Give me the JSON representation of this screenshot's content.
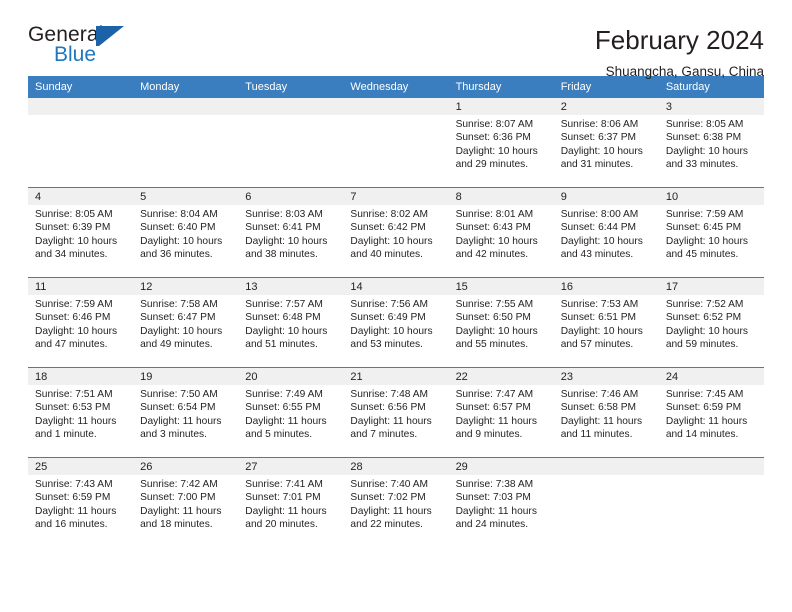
{
  "brand": {
    "word_one": "General",
    "word_two": "Blue",
    "flag_icon": "blue-flag-triangle-icon"
  },
  "header": {
    "month_title": "February 2024",
    "location": "Shuangcha, Gansu, China"
  },
  "colors": {
    "header_blue": "#3a7ebf",
    "row_divider_blue": "#3a7ebf",
    "daynum_band_gray": "#f0f0f0",
    "brand_blue": "#1f77bf",
    "text": "#231f20"
  },
  "calendar": {
    "day_headers": [
      "Sunday",
      "Monday",
      "Tuesday",
      "Wednesday",
      "Thursday",
      "Friday",
      "Saturday"
    ],
    "weeks": [
      [
        {
          "day": "",
          "lines": []
        },
        {
          "day": "",
          "lines": []
        },
        {
          "day": "",
          "lines": []
        },
        {
          "day": "",
          "lines": []
        },
        {
          "day": "1",
          "lines": [
            "Sunrise: 8:07 AM",
            "Sunset: 6:36 PM",
            "Daylight: 10 hours",
            "and 29 minutes."
          ]
        },
        {
          "day": "2",
          "lines": [
            "Sunrise: 8:06 AM",
            "Sunset: 6:37 PM",
            "Daylight: 10 hours",
            "and 31 minutes."
          ]
        },
        {
          "day": "3",
          "lines": [
            "Sunrise: 8:05 AM",
            "Sunset: 6:38 PM",
            "Daylight: 10 hours",
            "and 33 minutes."
          ]
        }
      ],
      [
        {
          "day": "4",
          "lines": [
            "Sunrise: 8:05 AM",
            "Sunset: 6:39 PM",
            "Daylight: 10 hours",
            "and 34 minutes."
          ]
        },
        {
          "day": "5",
          "lines": [
            "Sunrise: 8:04 AM",
            "Sunset: 6:40 PM",
            "Daylight: 10 hours",
            "and 36 minutes."
          ]
        },
        {
          "day": "6",
          "lines": [
            "Sunrise: 8:03 AM",
            "Sunset: 6:41 PM",
            "Daylight: 10 hours",
            "and 38 minutes."
          ]
        },
        {
          "day": "7",
          "lines": [
            "Sunrise: 8:02 AM",
            "Sunset: 6:42 PM",
            "Daylight: 10 hours",
            "and 40 minutes."
          ]
        },
        {
          "day": "8",
          "lines": [
            "Sunrise: 8:01 AM",
            "Sunset: 6:43 PM",
            "Daylight: 10 hours",
            "and 42 minutes."
          ]
        },
        {
          "day": "9",
          "lines": [
            "Sunrise: 8:00 AM",
            "Sunset: 6:44 PM",
            "Daylight: 10 hours",
            "and 43 minutes."
          ]
        },
        {
          "day": "10",
          "lines": [
            "Sunrise: 7:59 AM",
            "Sunset: 6:45 PM",
            "Daylight: 10 hours",
            "and 45 minutes."
          ]
        }
      ],
      [
        {
          "day": "11",
          "lines": [
            "Sunrise: 7:59 AM",
            "Sunset: 6:46 PM",
            "Daylight: 10 hours",
            "and 47 minutes."
          ]
        },
        {
          "day": "12",
          "lines": [
            "Sunrise: 7:58 AM",
            "Sunset: 6:47 PM",
            "Daylight: 10 hours",
            "and 49 minutes."
          ]
        },
        {
          "day": "13",
          "lines": [
            "Sunrise: 7:57 AM",
            "Sunset: 6:48 PM",
            "Daylight: 10 hours",
            "and 51 minutes."
          ]
        },
        {
          "day": "14",
          "lines": [
            "Sunrise: 7:56 AM",
            "Sunset: 6:49 PM",
            "Daylight: 10 hours",
            "and 53 minutes."
          ]
        },
        {
          "day": "15",
          "lines": [
            "Sunrise: 7:55 AM",
            "Sunset: 6:50 PM",
            "Daylight: 10 hours",
            "and 55 minutes."
          ]
        },
        {
          "day": "16",
          "lines": [
            "Sunrise: 7:53 AM",
            "Sunset: 6:51 PM",
            "Daylight: 10 hours",
            "and 57 minutes."
          ]
        },
        {
          "day": "17",
          "lines": [
            "Sunrise: 7:52 AM",
            "Sunset: 6:52 PM",
            "Daylight: 10 hours",
            "and 59 minutes."
          ]
        }
      ],
      [
        {
          "day": "18",
          "lines": [
            "Sunrise: 7:51 AM",
            "Sunset: 6:53 PM",
            "Daylight: 11 hours",
            "and 1 minute."
          ]
        },
        {
          "day": "19",
          "lines": [
            "Sunrise: 7:50 AM",
            "Sunset: 6:54 PM",
            "Daylight: 11 hours",
            "and 3 minutes."
          ]
        },
        {
          "day": "20",
          "lines": [
            "Sunrise: 7:49 AM",
            "Sunset: 6:55 PM",
            "Daylight: 11 hours",
            "and 5 minutes."
          ]
        },
        {
          "day": "21",
          "lines": [
            "Sunrise: 7:48 AM",
            "Sunset: 6:56 PM",
            "Daylight: 11 hours",
            "and 7 minutes."
          ]
        },
        {
          "day": "22",
          "lines": [
            "Sunrise: 7:47 AM",
            "Sunset: 6:57 PM",
            "Daylight: 11 hours",
            "and 9 minutes."
          ]
        },
        {
          "day": "23",
          "lines": [
            "Sunrise: 7:46 AM",
            "Sunset: 6:58 PM",
            "Daylight: 11 hours",
            "and 11 minutes."
          ]
        },
        {
          "day": "24",
          "lines": [
            "Sunrise: 7:45 AM",
            "Sunset: 6:59 PM",
            "Daylight: 11 hours",
            "and 14 minutes."
          ]
        }
      ],
      [
        {
          "day": "25",
          "lines": [
            "Sunrise: 7:43 AM",
            "Sunset: 6:59 PM",
            "Daylight: 11 hours",
            "and 16 minutes."
          ]
        },
        {
          "day": "26",
          "lines": [
            "Sunrise: 7:42 AM",
            "Sunset: 7:00 PM",
            "Daylight: 11 hours",
            "and 18 minutes."
          ]
        },
        {
          "day": "27",
          "lines": [
            "Sunrise: 7:41 AM",
            "Sunset: 7:01 PM",
            "Daylight: 11 hours",
            "and 20 minutes."
          ]
        },
        {
          "day": "28",
          "lines": [
            "Sunrise: 7:40 AM",
            "Sunset: 7:02 PM",
            "Daylight: 11 hours",
            "and 22 minutes."
          ]
        },
        {
          "day": "29",
          "lines": [
            "Sunrise: 7:38 AM",
            "Sunset: 7:03 PM",
            "Daylight: 11 hours",
            "and 24 minutes."
          ]
        },
        {
          "day": "",
          "lines": []
        },
        {
          "day": "",
          "lines": []
        }
      ]
    ]
  }
}
